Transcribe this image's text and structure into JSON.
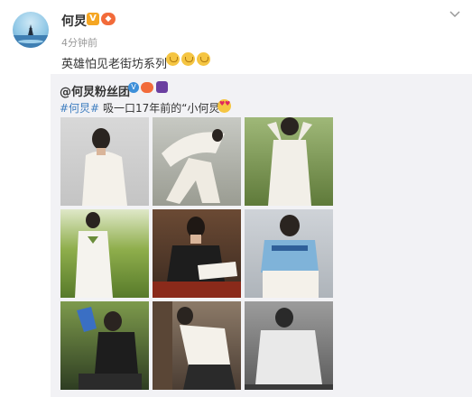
{
  "post": {
    "username": "何炅",
    "verified_badge": "V",
    "member_badge": "icon-member",
    "time": "4分钟前",
    "text": "英雄怕见老街坊系列",
    "emojis": [
      "laugh-icon",
      "laugh-icon",
      "laugh-icon"
    ]
  },
  "repost": {
    "username": "@何炅粉丝团",
    "text_tag": "#何炅#",
    "text_body": " 吸一口17年前的“小何炅”",
    "photos": [
      {
        "name": "photo-1",
        "scene": "white-shirt-backdrop"
      },
      {
        "name": "photo-2",
        "scene": "white-suit-jump"
      },
      {
        "name": "photo-3",
        "scene": "white-suit-field"
      },
      {
        "name": "photo-4",
        "scene": "white-suit-grass"
      },
      {
        "name": "photo-5",
        "scene": "desk-reading"
      },
      {
        "name": "photo-6",
        "scene": "blue-shirt-studio"
      },
      {
        "name": "photo-7",
        "scene": "sneaker-outdoor"
      },
      {
        "name": "photo-8",
        "scene": "white-tee-bookshelf"
      },
      {
        "name": "photo-9",
        "scene": "bw-white-shirt"
      }
    ]
  },
  "colors": {
    "link": "#3f7ec0",
    "repost_bg": "#f2f2f5",
    "badge_orange": "#f5a623"
  }
}
